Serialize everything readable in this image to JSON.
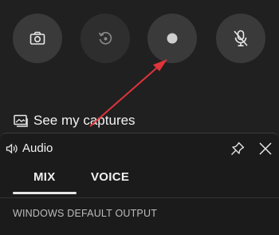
{
  "capture": {
    "buttons": [
      {
        "name": "screenshot",
        "icon": "camera-icon"
      },
      {
        "name": "record-last",
        "icon": "record-last-icon"
      },
      {
        "name": "record",
        "icon": "record-dot-icon"
      },
      {
        "name": "mic-toggle",
        "icon": "mic-off-icon"
      }
    ],
    "see_captures_label": "See my captures"
  },
  "audio": {
    "title": "Audio",
    "tabs": [
      {
        "label": "MIX",
        "selected": true
      },
      {
        "label": "VOICE",
        "selected": false
      }
    ],
    "section_label": "WINDOWS DEFAULT OUTPUT"
  },
  "colors": {
    "annotation_arrow": "#e0343a",
    "button_bg": "#3a3a3a",
    "panel_bg": "#1b1b1b"
  }
}
